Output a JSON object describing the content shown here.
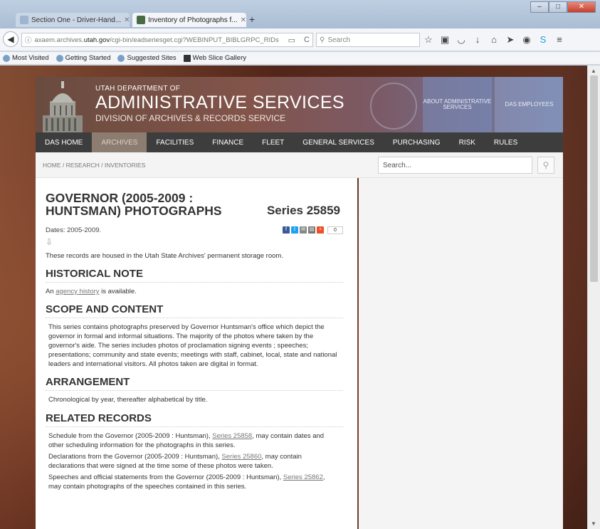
{
  "browser": {
    "tabs": [
      {
        "label": "Section One - Driver-Hand...",
        "active": false
      },
      {
        "label": "Inventory of Photographs f...",
        "active": true
      }
    ],
    "new_tab": "+",
    "url_prefix": "axaem.archives.",
    "url_domain": "utah.gov",
    "url_path": "/cgi-bin/eadseriesget.cgi?WEBINPUT_BIBLGRPC_RIDs",
    "search_placeholder": "Search",
    "bookmarks": [
      "Most Visited",
      "Getting Started",
      "Suggested Sites",
      "Web Slice Gallery"
    ]
  },
  "header": {
    "dept_line": "UTAH DEPARTMENT OF",
    "dept_name": "ADMINISTRATIVE SERVICES",
    "division": "DIVISION OF ARCHIVES & RECORDS SERVICE",
    "about_link": "ABOUT ADMINISTRATIVE SERVICES",
    "employees_link": "DAS EMPLOYEES"
  },
  "nav": {
    "items": [
      "DAS HOME",
      "ARCHIVES",
      "FACILITIES",
      "FINANCE",
      "FLEET",
      "GENERAL SERVICES",
      "PURCHASING",
      "RISK",
      "RULES"
    ],
    "active": "ARCHIVES"
  },
  "breadcrumb": "HOME / RESEARCH / INVENTORIES",
  "site_search": {
    "placeholder": "Search..."
  },
  "record": {
    "title": "GOVERNOR (2005-2009 : HUNTSMAN) PHOTOGRAPHS",
    "series": "Series 25859",
    "dates": "Dates: 2005-2009.",
    "share_count": "0",
    "storage_note": "These records are housed in the Utah State Archives' permanent storage room.",
    "historical_heading": "HISTORICAL NOTE",
    "historical_pre": "An ",
    "historical_link": "agency history",
    "historical_post": " is available.",
    "scope_heading": "SCOPE AND CONTENT",
    "scope_text": "This series contains photographs preserved by Governor Huntsman's office which depict the governor in formal and informal situations. The majority of the photos where taken by the governor's aide. The series includes photos of proclamation signing events ; speeches; presentations; community and state events; meetings with staff, cabinet, local, state and national leaders and international visitors. All photos taken are digital in format.",
    "arrangement_heading": "ARRANGEMENT",
    "arrangement_text": "Chronological by year, thereafter alphabetical by title.",
    "related_heading": "RELATED RECORDS",
    "related": [
      {
        "pre": "Schedule from the Governor (2005-2009 : Huntsman), ",
        "link": "Series 25858",
        "post": ", may contain dates and other scheduling information for the photographs in this series."
      },
      {
        "pre": "Declarations from the Governor (2005-2009 : Huntsman), ",
        "link": "Series 25860",
        "post": ", may contain declarations that were signed at the time some of these photos were taken."
      },
      {
        "pre": "Speeches and official statements from the Governor (2005-2009 : Huntsman), ",
        "link": "Series 25862",
        "post": ", may contain photographs of the speeches contained in this series."
      }
    ]
  }
}
